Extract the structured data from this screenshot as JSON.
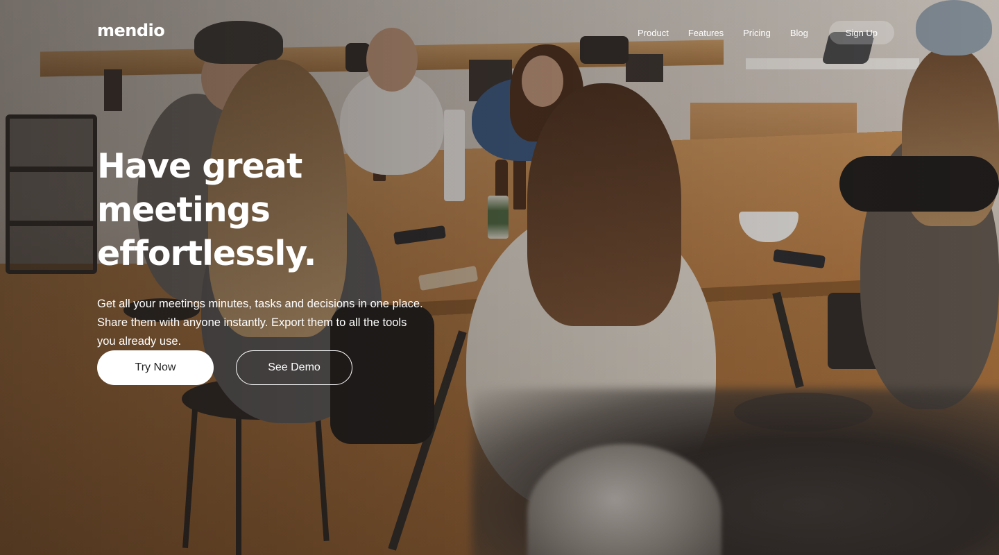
{
  "brand": {
    "logo_text": "mendio"
  },
  "nav": {
    "links": [
      {
        "label": "Product"
      },
      {
        "label": "Features"
      },
      {
        "label": "Pricing"
      },
      {
        "label": "Blog"
      }
    ],
    "signup_label": "Sign Up"
  },
  "hero": {
    "headline_line1": "Have great meetings",
    "headline_line2": "effortlessly.",
    "subtext": "Get all your meetings minutes, tasks and decisions in one place. Share them with anyone instantly. Export them to all the tools you already use.",
    "primary_cta": "Try Now",
    "secondary_cta": "See Demo"
  }
}
